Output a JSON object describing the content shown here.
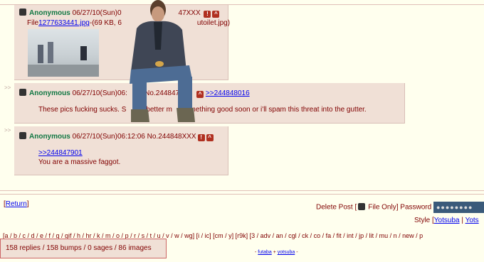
{
  "arrow_glyph": ">>",
  "post1": {
    "name": "Anonymous",
    "datetime": "06/27/10(Sun)0",
    "number": "47XXX",
    "file_prefix": "File",
    "file_link": "1277633441.jpg",
    "file_info": "-(69 KB, 6",
    "file_tail": "utoilet.jpg)"
  },
  "post2": {
    "name": "Anonymous",
    "datetime": "06/27/10(Sun)06:",
    "number_frag": "6 No.244847",
    "quote_link": ">>244848016",
    "text_before": "These pics fucking sucks. S",
    "text_mid": "ag better m",
    "text_after": "something good soon or i'll spam this threat into the gutter."
  },
  "post3": {
    "name": "Anonymous",
    "datetime": "06/27/10(Sun)06:12:06",
    "number": "No.244848XXX",
    "quote_link": ">>244847901",
    "text": "You are a massive faggot."
  },
  "icons": {
    "report": "!",
    "menu": "^"
  },
  "return_link": "Return",
  "delete": {
    "label": "Delete Post [",
    "file_only": "File Only]",
    "password_label": "Password",
    "password_value": "●●●●●●●●"
  },
  "style": {
    "label": "Style [",
    "option1": "Yotsuba",
    "option2": "Yots"
  },
  "boards": "[a / b / c / d / e / f / g / gif / h / hr / k / m / o / p / r / s / t / u / v / w / wg] [i / ic] [cm / y] [r9k] [3 / adv / an / cgl / ck / co / fa / fit / int / jp / lit / mu / n / new / p",
  "stats": "158 replies / 158 bumps / 0 sages / 86 images",
  "footer": {
    "part1": "- ",
    "futaba": "futaba",
    "plus": " + ",
    "yotsuba": "yotsuba",
    "part2": " -"
  },
  "colors": {
    "background": "#ffffee",
    "post_bg": "#f0e0d6",
    "name": "#117743",
    "text": "#800000",
    "link": "#0000ee"
  }
}
